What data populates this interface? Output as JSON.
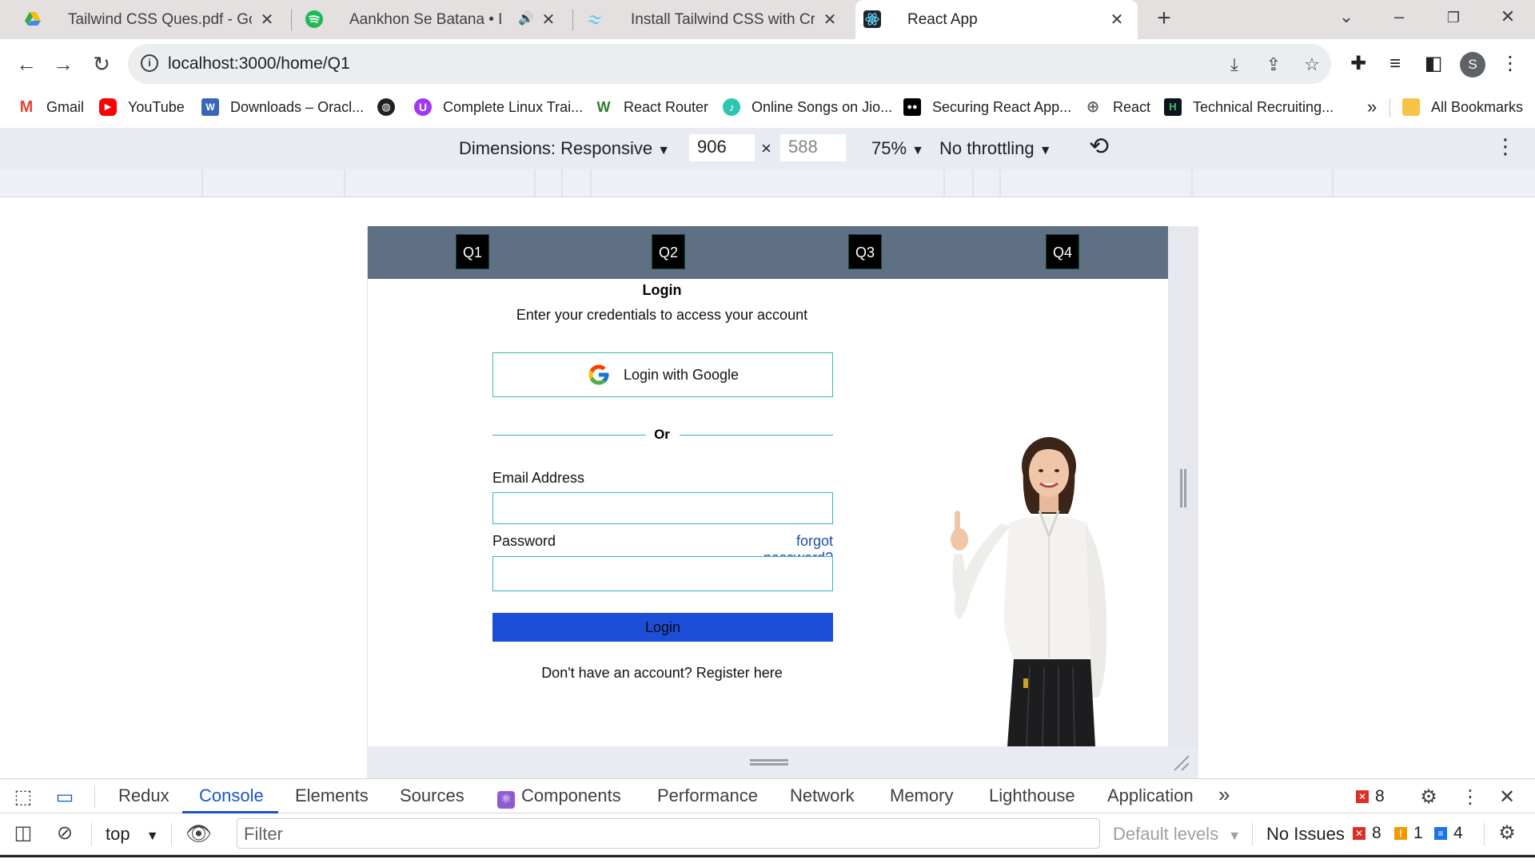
{
  "browser": {
    "tabs": [
      {
        "title": "Tailwind CSS Ques.pdf - Google",
        "icon": "google-drive-icon",
        "active": false
      },
      {
        "title": "Aankhon Se Batana • Diksha",
        "icon": "spotify-icon",
        "active": false
      },
      {
        "title": "Install Tailwind CSS with Create R",
        "icon": "tailwind-icon",
        "active": false
      },
      {
        "title": "React App",
        "icon": "react-icon",
        "active": true
      }
    ],
    "url": "localhost:3000/home/Q1",
    "profile_initial": "S",
    "bookmarks": [
      {
        "label": "Gmail",
        "icon": "gmail-icon"
      },
      {
        "label": "YouTube",
        "icon": "youtube-icon"
      },
      {
        "label": "Downloads – Oracl...",
        "icon": "oracle-icon"
      },
      {
        "label": "",
        "icon": "globe-icon"
      },
      {
        "label": "Complete Linux Trai...",
        "icon": "udemy-icon"
      },
      {
        "label": "React Router",
        "icon": "remix-icon"
      },
      {
        "label": "Online Songs on Jio...",
        "icon": "jiosaavn-icon"
      },
      {
        "label": "Securing React App...",
        "icon": "medium-icon"
      },
      {
        "label": "React",
        "icon": "globe-icon"
      },
      {
        "label": "Technical Recruiting...",
        "icon": "hackerrank-icon"
      }
    ],
    "bookmarks_overflow": "»",
    "all_bookmarks": "All Bookmarks"
  },
  "device_toolbar": {
    "dimensions_label": "Dimensions: Responsive",
    "width": "906",
    "times": "×",
    "height": "588",
    "zoom": "75%",
    "throttling": "No throttling"
  },
  "page": {
    "nav": [
      "Q1",
      "Q2",
      "Q3",
      "Q4"
    ],
    "title": "Login",
    "subtitle": "Enter your credentials to access your account",
    "google_button": "Login with Google",
    "divider": "Or",
    "email_label": "Email Address",
    "email_value": "",
    "password_label": "Password",
    "password_value": "",
    "forgot_link": "forgot password?",
    "login_button": "Login",
    "register_text": "Don't have an account? Register here"
  },
  "devtools": {
    "tabs": [
      "Redux",
      "Console",
      "Elements",
      "Sources",
      "Components",
      "Performance",
      "Network",
      "Memory",
      "Lighthouse",
      "Application"
    ],
    "active_tab": "Console",
    "more": "»",
    "error_count": "8",
    "context": "top",
    "filter_placeholder": "Filter",
    "levels": "Default levels",
    "issues_label": "No Issues",
    "issues_errors": "8",
    "issues_warnings": "1",
    "issues_info": "4",
    "colors": {
      "accent": "#1a56c5",
      "error": "#d93025",
      "warning": "#f29900",
      "info": "#1a73e8"
    }
  }
}
